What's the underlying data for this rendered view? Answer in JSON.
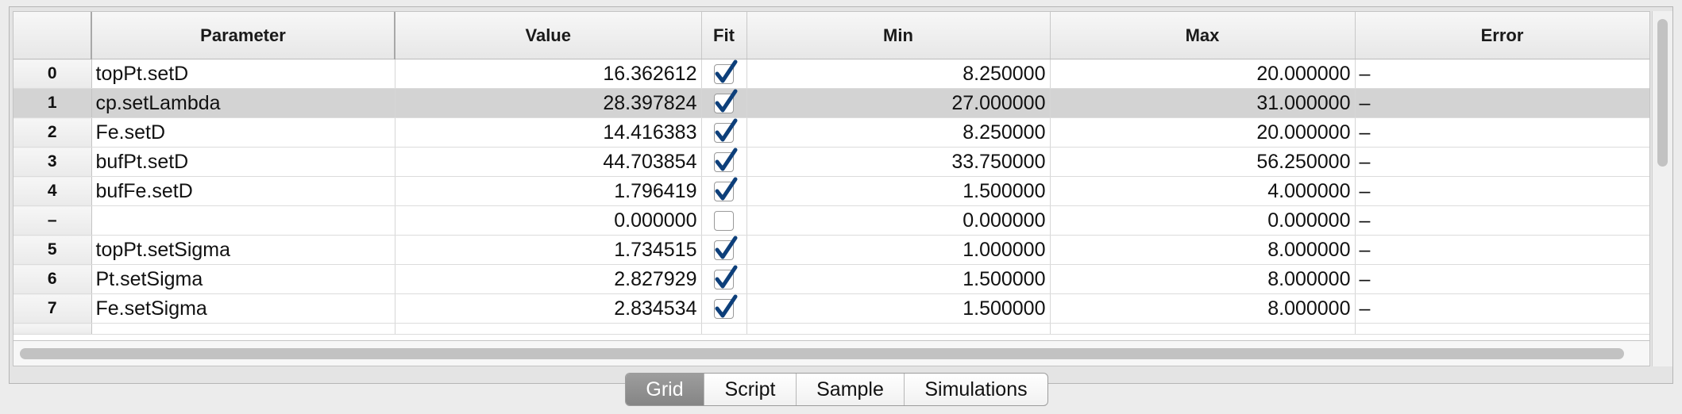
{
  "grid": {
    "columns": {
      "index": "",
      "parameter": "Parameter",
      "value": "Value",
      "fit": "Fit",
      "min": "Min",
      "max": "Max",
      "error": "Error"
    },
    "rows": [
      {
        "index": "0",
        "parameter": "topPt.setD",
        "value": "16.362612",
        "fit": true,
        "min": "8.250000",
        "max": "20.000000",
        "error": "–"
      },
      {
        "index": "1",
        "parameter": "cp.setLambda",
        "value": "28.397824",
        "fit": true,
        "min": "27.000000",
        "max": "31.000000",
        "error": "–",
        "selected": true
      },
      {
        "index": "2",
        "parameter": "Fe.setD",
        "value": "14.416383",
        "fit": true,
        "min": "8.250000",
        "max": "20.000000",
        "error": "–"
      },
      {
        "index": "3",
        "parameter": "bufPt.setD",
        "value": "44.703854",
        "fit": true,
        "min": "33.750000",
        "max": "56.250000",
        "error": "–"
      },
      {
        "index": "4",
        "parameter": "bufFe.setD",
        "value": "1.796419",
        "fit": true,
        "min": "1.500000",
        "max": "4.000000",
        "error": "–"
      },
      {
        "index": "–",
        "parameter": "",
        "value": "0.000000",
        "fit": false,
        "min": "0.000000",
        "max": "0.000000",
        "error": "–"
      },
      {
        "index": "5",
        "parameter": "topPt.setSigma",
        "value": "1.734515",
        "fit": true,
        "min": "1.000000",
        "max": "8.000000",
        "error": "–"
      },
      {
        "index": "6",
        "parameter": "Pt.setSigma",
        "value": "2.827929",
        "fit": true,
        "min": "1.500000",
        "max": "8.000000",
        "error": "–"
      },
      {
        "index": "7",
        "parameter": "Fe.setSigma",
        "value": "2.834534",
        "fit": true,
        "min": "1.500000",
        "max": "8.000000",
        "error": "–"
      }
    ]
  },
  "tabs": [
    {
      "label": "Grid",
      "active": true
    },
    {
      "label": "Script",
      "active": false
    },
    {
      "label": "Sample",
      "active": false
    },
    {
      "label": "Simulations",
      "active": false
    }
  ]
}
